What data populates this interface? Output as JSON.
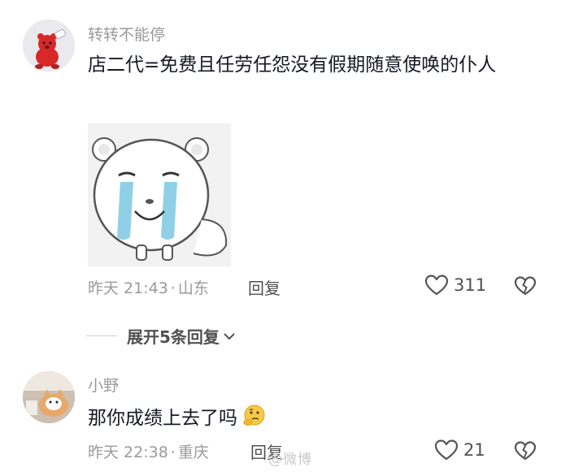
{
  "comments": [
    {
      "username": "转转不能停",
      "text": "店二代=免费且任劳任怨没有假期随意使唤的仆人",
      "time": "昨天 21:43",
      "separator": "·",
      "location": "山东",
      "reply_label": "回复",
      "likes": "311",
      "avatar_icon": "red-bear-avatar-icon",
      "sticker_icon": "crying-bear-sticker-icon"
    },
    {
      "username": "小野",
      "text": "那你成绩上去了吗",
      "time": "昨天 22:38",
      "separator": "·",
      "location": "重庆",
      "reply_label": "回复",
      "likes": "21",
      "avatar_icon": "cat-photo-avatar-icon",
      "emoji_icon": "thinking-face-emoji-icon"
    }
  ],
  "expand_replies": {
    "label": "展开5条回复",
    "icon": "chevron-down-icon"
  },
  "watermark_text": "@微博"
}
